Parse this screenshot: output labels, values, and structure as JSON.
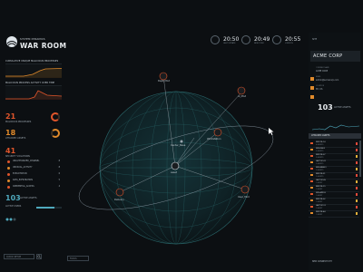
{
  "brand": {
    "subtitle": "SYSTEM DYNAMICS",
    "title": "WAR ROOM"
  },
  "left": {
    "chart1_title": "CUMULATIVE UNIQUE MALICIOUS PROCESSES",
    "chart2_title": "MALICIOUS PROCESS ACTIVITY OVER TIME",
    "stat1": {
      "value": "21",
      "label": "MALICIOUS PROCESSES"
    },
    "stat2": {
      "value": "18",
      "label": "ATTACKED ASSETS"
    },
    "stat3": {
      "value": "41",
      "label": "SECURITY VIOLATIONS"
    },
    "violations": [
      {
        "label": "UNAUTHORIZED_CHANNEL",
        "value": "8"
      },
      {
        "label": "UNUSUAL_ACTIVITY",
        "value": "8"
      },
      {
        "label": "EXPLOITATION",
        "value": "6"
      },
      {
        "label": "DATA_EXFILTRATION",
        "value": "5"
      },
      {
        "label": "CREDENTIAL_ACCESS",
        "value": "4"
      }
    ],
    "active_assets": {
      "value": "103",
      "label": "ACTIVE ASSETS"
    },
    "active_users_label": "ACTIVE USERS",
    "search_placeholder": "QUICK SETUP"
  },
  "clocks": [
    {
      "time": "20:50",
      "sub": "LAST UPDATE"
    },
    {
      "time": "20:49",
      "sub": "NEW YORK"
    },
    {
      "time": "20:55",
      "sub": "LONDON"
    }
  ],
  "globe_nodes": [
    {
      "label": "Dept_Mod"
    },
    {
      "label": "ui_Mod"
    },
    {
      "label": "Workstation"
    },
    {
      "label": "Center_Base"
    },
    {
      "label": "asset"
    },
    {
      "label": "Delivery"
    },
    {
      "label": "User_Mod"
    }
  ],
  "zoom_label": "FOCUS",
  "right": {
    "top_label": "SITE",
    "company": "ACME CORP",
    "fields": [
      {
        "key": "COMPANY NAME",
        "value": "ACME CORP"
      },
      {
        "key": "EMAIL",
        "value": "admin@acmecorp.com"
      },
      {
        "key": "LOCATION",
        "value": "NY, US"
      }
    ],
    "assets_value": "103",
    "assets_label": "ACTIVE ASSETS",
    "table_header": "ATTACKED ASSETS",
    "rows": [
      {
        "title": "WKSTN-14",
        "sub": "4 ALERTS",
        "tag": "#e0552b",
        "flag": "#e24a3a"
      },
      {
        "title": "SRV-DB02",
        "sub": "3 ALERTS",
        "tag": "#e08a2b",
        "flag": "#e24a3a"
      },
      {
        "title": "WKSTN-07",
        "sub": "3 ALERTS",
        "tag": "#e0552b",
        "flag": "#e2b03a"
      },
      {
        "title": "LAPTOP-22",
        "sub": "2 ALERTS",
        "tag": "#e08a2b",
        "flag": "#e24a3a"
      },
      {
        "title": "SRV-WEB01",
        "sub": "2 ALERTS",
        "tag": "#e0552b",
        "flag": "#e2b03a"
      },
      {
        "title": "WKSTN-31",
        "sub": "2 ALERTS",
        "tag": "#e08a2b",
        "flag": "#e24a3a"
      },
      {
        "title": "LAPTOP-05",
        "sub": "1 ALERT",
        "tag": "#e0552b",
        "flag": "#e2b03a"
      },
      {
        "title": "WKSTN-19",
        "sub": "1 ALERT",
        "tag": "#e08a2b",
        "flag": "#e24a3a"
      },
      {
        "title": "SRV-APP03",
        "sub": "1 ALERT",
        "tag": "#e0552b",
        "flag": "#e24a3a"
      },
      {
        "title": "WKSTN-02",
        "sub": "1 ALERT",
        "tag": "#e08a2b",
        "flag": "#e2b03a"
      },
      {
        "title": "LAPTOP-11",
        "sub": "1 ALERT",
        "tag": "#e0552b",
        "flag": "#e24a3a"
      },
      {
        "title": "WKSTN-44",
        "sub": "1 ALERT",
        "tag": "#e08a2b",
        "flag": "#e2b03a"
      }
    ],
    "footer": "NEW CONNECTIVITY"
  },
  "colors": {
    "accent": "#e0552b",
    "orange": "#e08a2b",
    "globe": "#2b6b6f",
    "bg": "#0c0f12"
  }
}
